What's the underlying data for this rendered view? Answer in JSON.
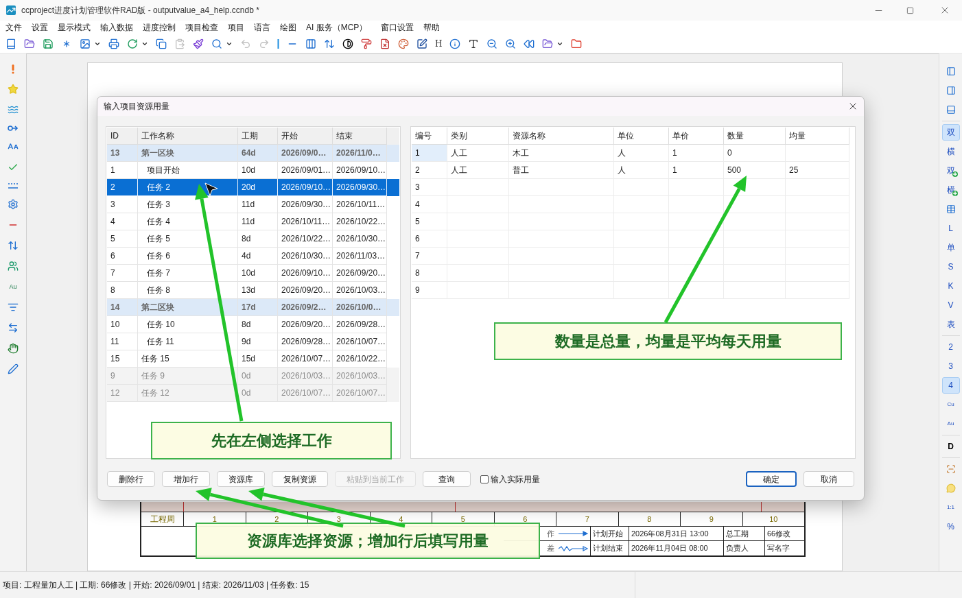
{
  "window": {
    "title": "ccproject进度计划管理软件RAD版 - outputvalue_a4_help.ccndb *"
  },
  "menu": [
    "文件",
    "设置",
    "显示模式",
    "输入数据",
    "进度控制",
    "项目检查",
    "项目",
    "语言",
    "绘图",
    "AI 服务（MCP）",
    "窗口设置",
    "帮助"
  ],
  "toolbar": [
    {
      "kind": "icon",
      "disabled": false
    },
    {
      "kind": "icon",
      "disabled": false
    },
    {
      "kind": "icon",
      "disabled": false
    },
    {
      "kind": "icon",
      "disabled": false
    },
    {
      "kind": "icon",
      "disabled": false
    },
    {
      "kind": "caret",
      "disabled": false
    },
    {
      "kind": "icon",
      "disabled": false
    },
    {
      "kind": "icon",
      "disabled": false
    },
    {
      "kind": "caret",
      "disabled": false
    },
    {
      "kind": "icon",
      "disabled": false
    },
    {
      "kind": "icon",
      "disabled": true
    },
    {
      "kind": "icon",
      "disabled": false
    },
    {
      "kind": "icon",
      "disabled": false
    },
    {
      "kind": "caret",
      "disabled": false
    },
    {
      "kind": "icon",
      "disabled": true
    },
    {
      "kind": "icon",
      "disabled": true
    },
    {
      "kind": "icon",
      "disabled": false
    },
    {
      "kind": "icon",
      "disabled": false
    },
    {
      "kind": "icon",
      "disabled": false
    },
    {
      "kind": "icon",
      "disabled": false
    },
    {
      "kind": "icon",
      "disabled": false
    },
    {
      "kind": "icon",
      "disabled": false
    },
    {
      "kind": "icon",
      "disabled": false
    },
    {
      "kind": "icon",
      "disabled": false
    },
    {
      "kind": "icon",
      "disabled": false
    },
    {
      "kind": "text",
      "label": "H",
      "disabled": false
    },
    {
      "kind": "icon",
      "disabled": false
    },
    {
      "kind": "icon",
      "disabled": false
    },
    {
      "kind": "icon",
      "disabled": false
    },
    {
      "kind": "icon",
      "disabled": false
    },
    {
      "kind": "icon",
      "disabled": false
    },
    {
      "kind": "icon",
      "disabled": false
    },
    {
      "kind": "caret",
      "disabled": false
    },
    {
      "kind": "icon",
      "disabled": false
    }
  ],
  "left_toolbar": [
    {
      "kind": "icon"
    },
    {
      "kind": "icon"
    },
    {
      "kind": "icon"
    },
    {
      "kind": "icon"
    },
    {
      "kind": "icon"
    },
    {
      "kind": "icon"
    },
    {
      "kind": "icon"
    },
    {
      "kind": "icon"
    },
    {
      "kind": "icon"
    },
    {
      "kind": "icon"
    },
    {
      "kind": "icon"
    },
    {
      "kind": "text",
      "label": "Au"
    },
    {
      "kind": "icon"
    },
    {
      "kind": "icon"
    },
    {
      "kind": "icon"
    },
    {
      "kind": "icon"
    }
  ],
  "right_toolbar": [
    {
      "kind": "icon",
      "selected": false
    },
    {
      "kind": "icon",
      "selected": false
    },
    {
      "kind": "icon",
      "selected": false
    },
    {
      "kind": "separator"
    },
    {
      "kind": "text",
      "label": "双",
      "selected": true,
      "badge": false
    },
    {
      "kind": "text",
      "label": "横",
      "selected": false,
      "badge": false
    },
    {
      "kind": "text",
      "label": "双",
      "selected": false,
      "badge": true
    },
    {
      "kind": "text",
      "label": "横",
      "selected": false,
      "badge": true
    },
    {
      "kind": "icon",
      "selected": false
    },
    {
      "kind": "text",
      "label": "L",
      "selected": false,
      "badge": false
    },
    {
      "kind": "text",
      "label": "单",
      "selected": false,
      "badge": false
    },
    {
      "kind": "text",
      "label": "S",
      "selected": false,
      "badge": false
    },
    {
      "kind": "text",
      "label": "K",
      "selected": false,
      "badge": false
    },
    {
      "kind": "text",
      "label": "V",
      "selected": false,
      "badge": false
    },
    {
      "kind": "text",
      "label": "表",
      "selected": false,
      "badge": false
    },
    {
      "kind": "separator"
    },
    {
      "kind": "text",
      "label": "2",
      "selected": false,
      "badge": false
    },
    {
      "kind": "text",
      "label": "3",
      "selected": false,
      "badge": false
    },
    {
      "kind": "text",
      "label": "4",
      "selected": true,
      "badge": false
    },
    {
      "kind": "text",
      "label": "Cu",
      "selected": false,
      "badge": false
    },
    {
      "kind": "text",
      "label": "Au",
      "selected": false,
      "badge": false
    },
    {
      "kind": "separator"
    },
    {
      "kind": "text",
      "label": "D",
      "selected": false,
      "badge": false
    },
    {
      "kind": "separator"
    },
    {
      "kind": "icon",
      "selected": false
    },
    {
      "kind": "icon",
      "selected": false
    },
    {
      "kind": "text",
      "label": "1:1",
      "selected": false,
      "badge": false
    },
    {
      "kind": "text",
      "label": "%",
      "selected": false,
      "badge": false
    }
  ],
  "schedule": {
    "week_label": "工程周",
    "weeks": [
      "1",
      "2",
      "3",
      "4",
      "5",
      "6",
      "7",
      "8",
      "9",
      "10"
    ],
    "legend": [
      {
        "kind": "solid",
        "label": "作"
      },
      {
        "kind": "wavy",
        "label": "差"
      }
    ],
    "info": [
      [
        "计划开始",
        "2026年08月31日 13:00",
        "总工期",
        "66修改"
      ],
      [
        "计划结束",
        "2026年11月04日 08:00",
        "负责人",
        "写名字"
      ]
    ]
  },
  "dialog": {
    "title": "输入项目资源用量",
    "tasks": {
      "columns": [
        "ID",
        "工作名称",
        "工期",
        "开始",
        "结束"
      ],
      "rows": [
        {
          "kind": "group",
          "selected": false,
          "cells": [
            "13",
            "第一区块",
            "64d",
            "2026/09/0…",
            "2026/11/0…"
          ],
          "children": [
            {
              "kind": "task",
              "selected": false,
              "cells": [
                "1",
                "项目开始",
                "10d",
                "2026/09/01…",
                "2026/09/10…"
              ]
            },
            {
              "kind": "task",
              "selected": true,
              "cells": [
                "2",
                "任务 2",
                "20d",
                "2026/09/10…",
                "2026/09/30…"
              ]
            },
            {
              "kind": "task",
              "selected": false,
              "cells": [
                "3",
                "任务 3",
                "11d",
                "2026/09/30…",
                "2026/10/11…"
              ]
            },
            {
              "kind": "task",
              "selected": false,
              "cells": [
                "4",
                "任务 4",
                "11d",
                "2026/10/11…",
                "2026/10/22…"
              ]
            },
            {
              "kind": "task",
              "selected": false,
              "cells": [
                "5",
                "任务 5",
                "8d",
                "2026/10/22…",
                "2026/10/30…"
              ]
            },
            {
              "kind": "task",
              "selected": false,
              "cells": [
                "6",
                "任务 6",
                "4d",
                "2026/10/30…",
                "2026/11/03…"
              ]
            },
            {
              "kind": "task",
              "selected": false,
              "cells": [
                "7",
                "任务 7",
                "10d",
                "2026/09/10…",
                "2026/09/20…"
              ]
            },
            {
              "kind": "task",
              "selected": false,
              "cells": [
                "8",
                "任务 8",
                "13d",
                "2026/09/20…",
                "2026/10/03…"
              ]
            }
          ]
        },
        {
          "kind": "group",
          "selected": false,
          "cells": [
            "14",
            "第二区块",
            "17d",
            "2026/09/2…",
            "2026/10/0…"
          ],
          "children": [
            {
              "kind": "task",
              "selected": false,
              "cells": [
                "10",
                "任务 10",
                "8d",
                "2026/09/20…",
                "2026/09/28…"
              ]
            },
            {
              "kind": "task",
              "selected": false,
              "cells": [
                "11",
                "任务 11",
                "9d",
                "2026/09/28…",
                "2026/10/07…"
              ]
            }
          ]
        },
        {
          "kind": "task",
          "selected": false,
          "cells": [
            "15",
            "任务 15",
            "15d",
            "2026/10/07…",
            "2026/10/22…"
          ]
        },
        {
          "kind": "milestone",
          "selected": false,
          "cells": [
            "9",
            "任务 9",
            "0d",
            "2026/10/03…",
            "2026/10/03…"
          ]
        },
        {
          "kind": "milestone",
          "selected": false,
          "cells": [
            "12",
            "任务 12",
            "0d",
            "2026/10/07…",
            "2026/10/07…"
          ]
        }
      ]
    },
    "resources": {
      "columns": [
        "编号",
        "类别",
        "资源名称",
        "单位",
        "单价",
        "数量",
        "均量"
      ],
      "rows": [
        {
          "selected": true,
          "cells": [
            "1",
            "人工",
            "木工",
            "人",
            "1",
            "0",
            null
          ]
        },
        {
          "selected": false,
          "cells": [
            "2",
            "人工",
            "普工",
            "人",
            "1",
            "500",
            "25"
          ]
        },
        {
          "selected": false,
          "cells": [
            "3",
            null,
            null,
            null,
            null,
            null,
            null
          ]
        },
        {
          "selected": false,
          "cells": [
            "4",
            null,
            null,
            null,
            null,
            null,
            null
          ]
        },
        {
          "selected": false,
          "cells": [
            "5",
            null,
            null,
            null,
            null,
            null,
            null
          ]
        },
        {
          "selected": false,
          "cells": [
            "6",
            null,
            null,
            null,
            null,
            null,
            null
          ]
        },
        {
          "selected": false,
          "cells": [
            "7",
            null,
            null,
            null,
            null,
            null,
            null
          ]
        },
        {
          "selected": false,
          "cells": [
            "8",
            null,
            null,
            null,
            null,
            null,
            null
          ]
        },
        {
          "selected": false,
          "cells": [
            "9",
            null,
            null,
            null,
            null,
            null,
            null
          ]
        }
      ]
    },
    "buttons_left": [
      {
        "label": "删除行",
        "disabled": false
      },
      {
        "label": "增加行",
        "disabled": false
      },
      {
        "label": "资源库",
        "disabled": false
      },
      {
        "label": "复制资源",
        "disabled": false
      },
      {
        "label": "粘贴到当前工作",
        "disabled": true
      },
      {
        "label": "查询",
        "disabled": false
      }
    ],
    "checkbox": {
      "label": "输入实际用量",
      "checked": false
    },
    "buttons_right": [
      {
        "label": "确定",
        "default": true
      },
      {
        "label": "取消",
        "default": false
      }
    ]
  },
  "callouts": [
    {
      "text": "先在左侧选择工作"
    },
    {
      "text": "数量是总量，均量是平均每天用量"
    },
    {
      "text": "资源库选择资源；增加行后填写用量"
    }
  ],
  "status_bar": {
    "text": "项目: 工程量加人工 | 工期: 66修改 | 开始: 2026/09/01 | 结束: 2026/11/03 | 任务数: 15"
  }
}
